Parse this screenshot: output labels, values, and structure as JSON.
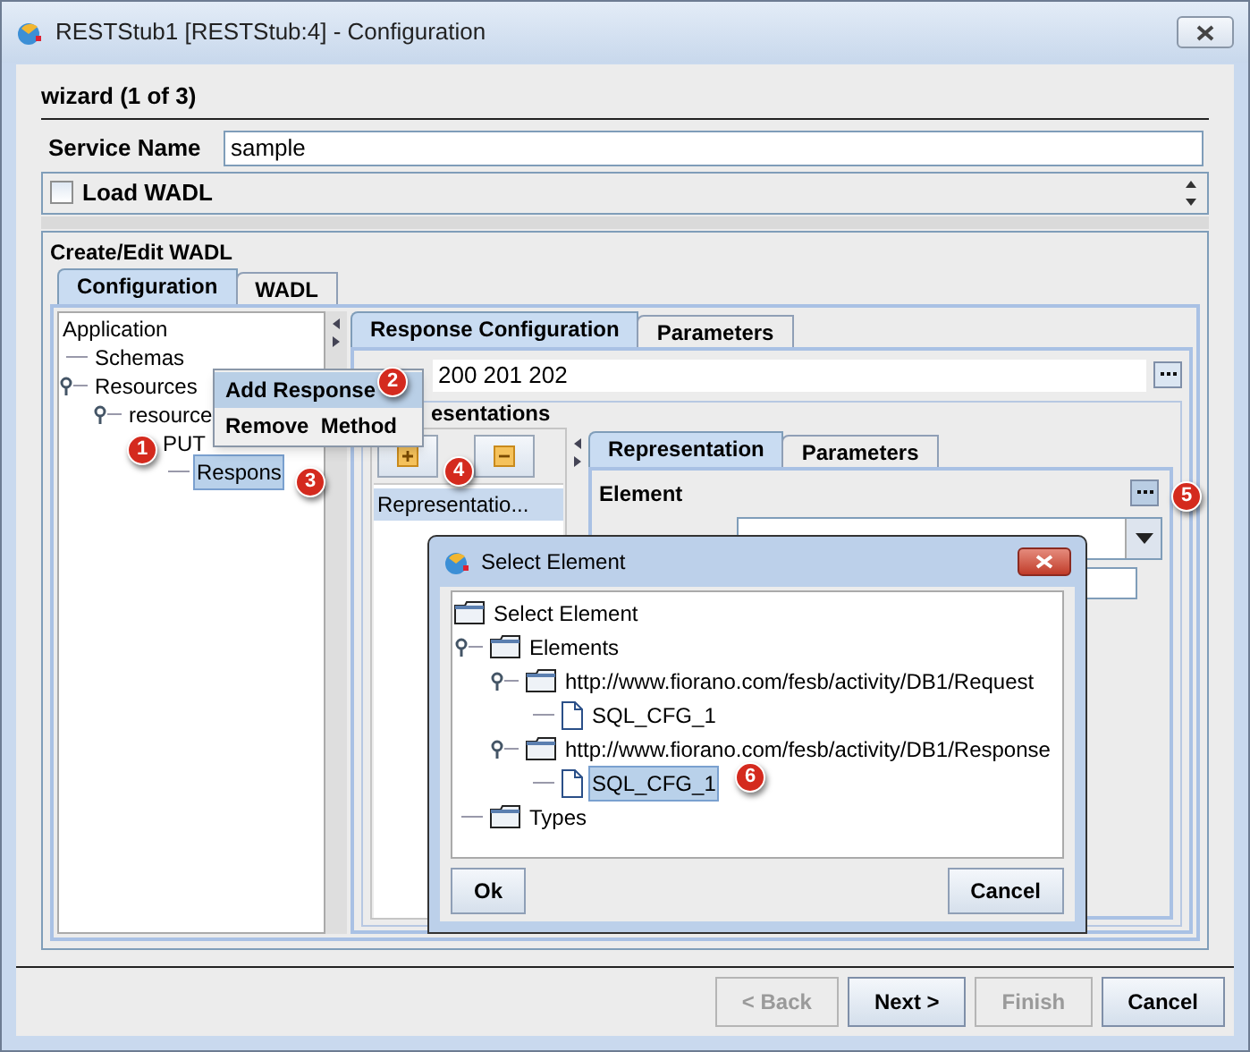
{
  "window": {
    "title": "RESTStub1 [RESTStub:4] - Configuration"
  },
  "wizard": {
    "step": "wizard (1 of 3)"
  },
  "service_name": {
    "label": "Service Name",
    "value": "sample"
  },
  "load_wadl": {
    "label": "Load WADL",
    "checked": false
  },
  "wadl_group": {
    "title": "Create/Edit WADL"
  },
  "main_tabs": [
    {
      "label": "Configuration",
      "selected": true
    },
    {
      "label": "WADL",
      "selected": false
    }
  ],
  "resource_tree": [
    {
      "label": "Application",
      "selected": false,
      "children": [
        {
          "label": "Schemas",
          "selected": false
        },
        {
          "label": "Resources",
          "selected": false,
          "children": [
            {
              "label": "resource",
              "selected": false,
              "children": [
                {
                  "label": "PUT",
                  "selected": false,
                  "children": [
                    {
                      "label": "Respons",
                      "selected": true
                    }
                  ]
                }
              ]
            }
          ]
        }
      ]
    }
  ],
  "response_tabs": [
    {
      "label": "Response Configuration",
      "selected": true
    },
    {
      "label": "Parameters",
      "selected": false
    }
  ],
  "status_codes": {
    "value": "200 201 202"
  },
  "representations": {
    "title": "esentations",
    "items": [
      {
        "label": "Representatio...",
        "selected": true
      }
    ]
  },
  "representation_tabs": [
    {
      "label": "Representation",
      "selected": true
    },
    {
      "label": "Parameters",
      "selected": false
    }
  ],
  "element": {
    "label": "Element"
  },
  "context_menu": [
    {
      "label": "Add Response",
      "selected": true
    },
    {
      "label": "Remove  Method",
      "selected": false
    }
  ],
  "dialog": {
    "title": "Select Element",
    "tree": [
      {
        "label": "Select Element",
        "kind": "folder",
        "selected": false,
        "children": [
          {
            "label": "Elements",
            "kind": "folder",
            "selected": false,
            "children": [
              {
                "label": "http://www.fiorano.com/fesb/activity/DB1/Request",
                "kind": "folder",
                "selected": false,
                "children": [
                  {
                    "label": "SQL_CFG_1",
                    "kind": "file",
                    "selected": false
                  }
                ]
              },
              {
                "label": "http://www.fiorano.com/fesb/activity/DB1/Response",
                "kind": "folder",
                "selected": false,
                "children": [
                  {
                    "label": "SQL_CFG_1",
                    "kind": "file",
                    "selected": true
                  }
                ]
              }
            ]
          },
          {
            "label": "Types",
            "kind": "folder",
            "selected": false
          }
        ]
      }
    ],
    "buttons": [
      "Ok",
      "Cancel"
    ]
  },
  "footer_buttons": [
    {
      "label": "< Back",
      "disabled": true
    },
    {
      "label": "Next >",
      "disabled": false
    },
    {
      "label": "Finish",
      "disabled": true
    },
    {
      "label": "Cancel",
      "disabled": false
    }
  ],
  "callouts": [
    "1",
    "2",
    "3",
    "4",
    "5",
    "6"
  ]
}
